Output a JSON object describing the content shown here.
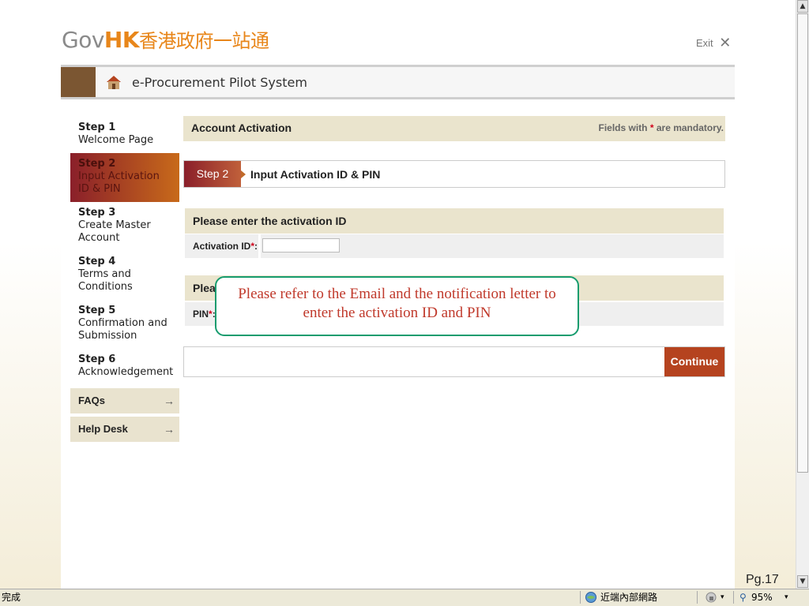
{
  "header": {
    "logo_gov": "Gov",
    "logo_hk": "HK",
    "logo_cn": "香港政府一站通",
    "exit_label": "Exit",
    "close_glyph": "✕"
  },
  "titlebar": {
    "title": "e-Procurement Pilot System"
  },
  "sidebar": {
    "steps": [
      {
        "step": "Step 1",
        "label": "Welcome Page"
      },
      {
        "step": "Step 2",
        "label": "Input Activation ID & PIN"
      },
      {
        "step": "Step 3",
        "label": "Create Master Account"
      },
      {
        "step": "Step 4",
        "label": "Terms and Conditions"
      },
      {
        "step": "Step 5",
        "label": "Confirmation and Submission"
      },
      {
        "step": "Step 6",
        "label": "Acknowledgement"
      }
    ],
    "faqs": "FAQs",
    "helpdesk": "Help Desk",
    "arrow_glyph": "→"
  },
  "main": {
    "title": "Account Activation",
    "mandatory_prefix": "Fields with ",
    "mandatory_star": "*",
    "mandatory_suffix": " are mandatory.",
    "step_tag": "Step 2",
    "step_label": "Input Activation ID & PIN",
    "activation_section": "Please enter the activation ID",
    "activation_label": "Activation ID",
    "activation_value": "",
    "pin_section": "Plea",
    "pin_label": "PIN",
    "req_mark": "*",
    "colon": ":",
    "continue": "Continue"
  },
  "callout": {
    "line1": "Please refer to the Email and the notification letter to",
    "line2": "enter the activation ID and PIN"
  },
  "footer": {
    "page": "Pg.17"
  },
  "statusbar": {
    "done": "完成",
    "zone": "近端內部網路",
    "zoom": "95%",
    "zoom_caret": "▾",
    "lock_caret": "▾"
  },
  "colors": {
    "accent": "#b5431f",
    "section_bg": "#eae4cd",
    "callout_border": "#179c6e",
    "callout_text": "#c0392b"
  }
}
